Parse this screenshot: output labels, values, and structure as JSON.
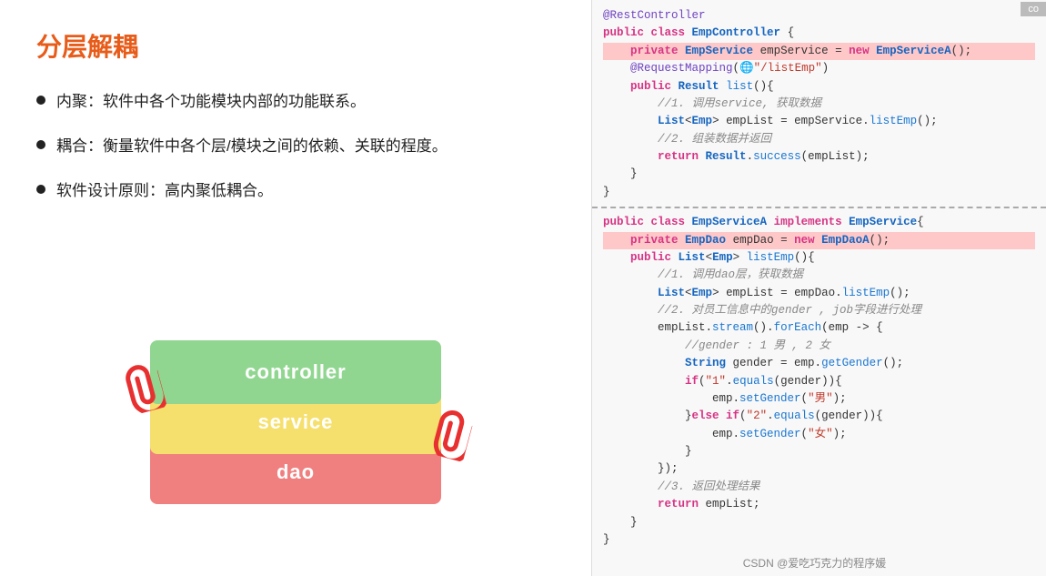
{
  "title": "分层解耦",
  "bullets": [
    "内聚：软件中各个功能模块内部的功能联系。",
    "耦合：衡量软件中各个层/模块之间的依赖、关联的程度。",
    "软件设计原则：高内聚低耦合。"
  ],
  "layers": {
    "controller": "controller",
    "service": "service",
    "dao": "dao"
  },
  "code_section1": {
    "lines": [
      {
        "text": "@RestController",
        "class": "ann",
        "bg": ""
      },
      {
        "text": "public class EmpController {",
        "class": "",
        "bg": ""
      },
      {
        "text": "    private EmpService empService = new EmpServiceA();",
        "class": "",
        "bg": "highlight-red"
      },
      {
        "text": "",
        "class": "",
        "bg": ""
      },
      {
        "text": "    @RequestMapping(🌐\"/listEmp\")",
        "class": "",
        "bg": ""
      },
      {
        "text": "    public Result list(){",
        "class": "",
        "bg": ""
      },
      {
        "text": "        //1. 调用service, 获取数据",
        "class": "cmt",
        "bg": ""
      },
      {
        "text": "        List<Emp> empList = empService.listEmp();",
        "class": "",
        "bg": ""
      },
      {
        "text": "        //2. 组装数据并返回",
        "class": "cmt",
        "bg": ""
      },
      {
        "text": "        return Result.success(empList);",
        "class": "",
        "bg": ""
      },
      {
        "text": "    }",
        "class": "",
        "bg": ""
      },
      {
        "text": "}",
        "class": "",
        "bg": ""
      }
    ]
  },
  "code_section2": {
    "lines": [
      {
        "text": "public class EmpServiceA implements EmpService{",
        "class": "",
        "bg": ""
      },
      {
        "text": "    private EmpDao empDao = new EmpDaoA();",
        "class": "",
        "bg": "highlight-red"
      },
      {
        "text": "",
        "class": "",
        "bg": ""
      },
      {
        "text": "    public List<Emp> listEmp(){",
        "class": "",
        "bg": ""
      },
      {
        "text": "        //1. 调用dao层，获取数据",
        "class": "cmt",
        "bg": ""
      },
      {
        "text": "        List<Emp> empList = empDao.listEmp();",
        "class": "",
        "bg": ""
      },
      {
        "text": "        //2. 对员工信息中的gender , job字段进行处理",
        "class": "cmt",
        "bg": ""
      },
      {
        "text": "        empList.stream().forEach(emp -> {",
        "class": "",
        "bg": ""
      },
      {
        "text": "            //gender : 1 男 , 2 女",
        "class": "cmt",
        "bg": ""
      },
      {
        "text": "            String gender = emp.getGender();",
        "class": "",
        "bg": ""
      },
      {
        "text": "            if(\"1\".equals(gender)){",
        "class": "",
        "bg": ""
      },
      {
        "text": "                emp.setGender(\"男\");",
        "class": "",
        "bg": ""
      },
      {
        "text": "            }else if(\"2\".equals(gender)){",
        "class": "",
        "bg": ""
      },
      {
        "text": "                emp.setGender(\"女\");",
        "class": "",
        "bg": ""
      },
      {
        "text": "            }",
        "class": "",
        "bg": ""
      },
      {
        "text": "        });",
        "class": "",
        "bg": ""
      },
      {
        "text": "        //3. 返回处理结果",
        "class": "cmt",
        "bg": ""
      },
      {
        "text": "        return empList;",
        "class": "",
        "bg": ""
      },
      {
        "text": "    }",
        "class": "",
        "bg": ""
      },
      {
        "text": "}",
        "class": "",
        "bg": ""
      }
    ]
  },
  "watermark": "CSDN @爱吃巧克力的程序媛",
  "copy_btn_label": "co"
}
